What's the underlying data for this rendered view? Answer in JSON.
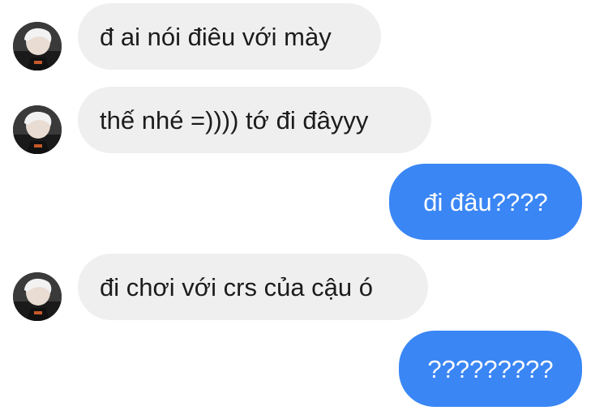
{
  "colors": {
    "incoming_bubble": "#efefef",
    "outgoing_bubble": "#3a86f5",
    "incoming_text": "#1c1c1c",
    "outgoing_text": "#ffffff"
  },
  "messages": [
    {
      "direction": "incoming",
      "text": "đ ai nói điêu với mày",
      "avatar": "avatar-photo"
    },
    {
      "direction": "incoming",
      "text": "thế nhé =)))) tớ đi đâyyy",
      "avatar": "avatar-photo"
    },
    {
      "direction": "outgoing",
      "text": "đi đâu????"
    },
    {
      "direction": "incoming",
      "text": "đi chơi với crs của cậu ó",
      "avatar": "avatar-photo"
    },
    {
      "direction": "outgoing",
      "text": "?????????"
    }
  ]
}
